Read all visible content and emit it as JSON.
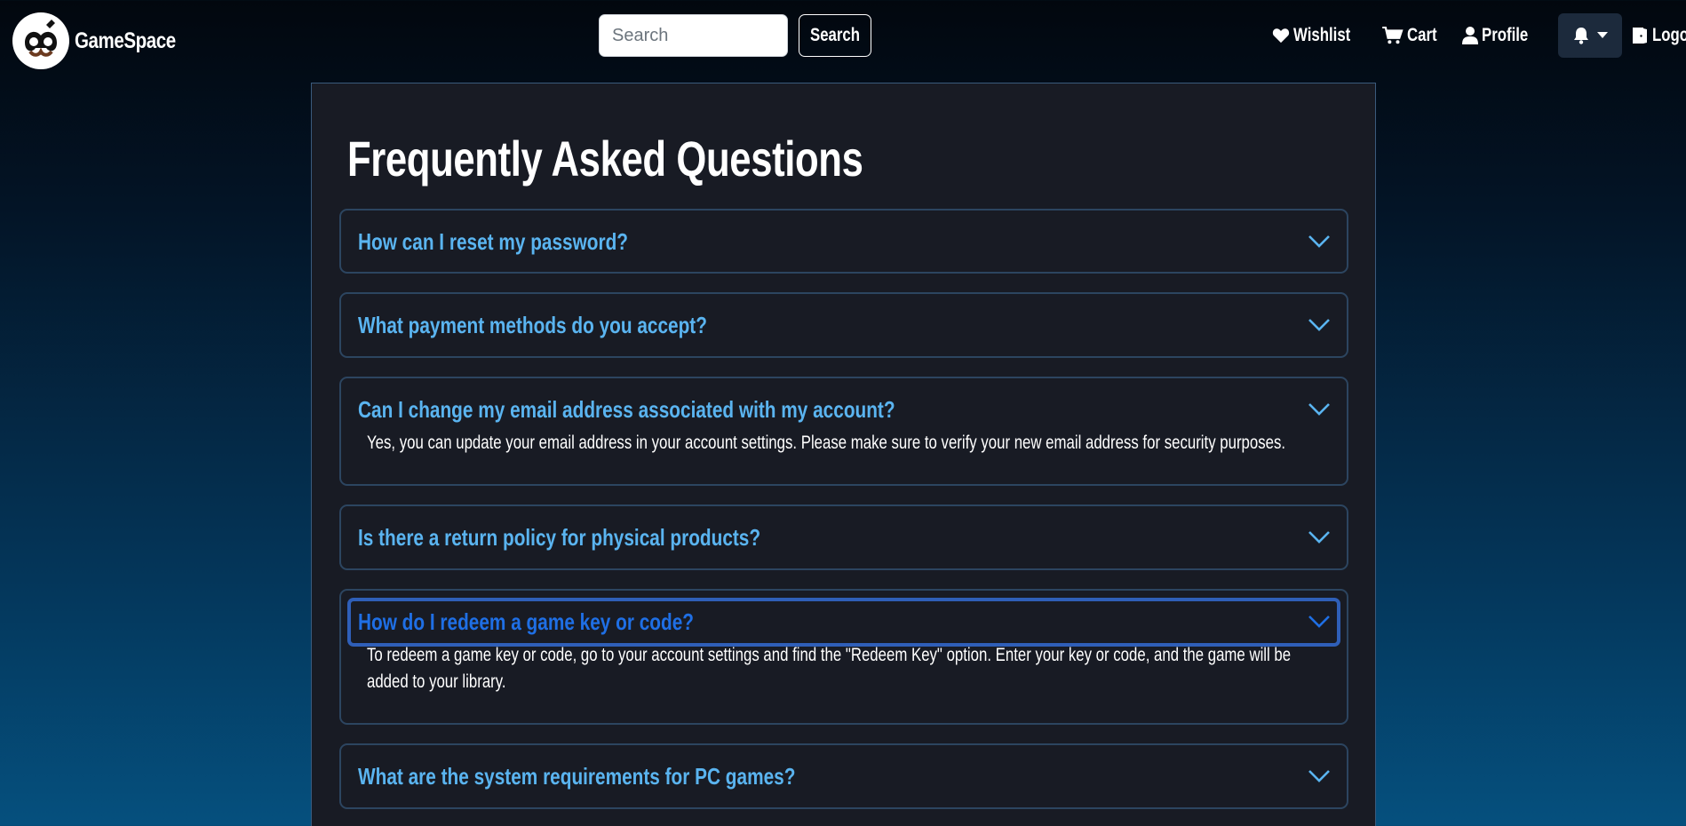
{
  "navbar": {
    "brand": "GameSpace",
    "search_placeholder": "Search",
    "search_button": "Search",
    "links": {
      "wishlist": "Wishlist",
      "cart": "Cart",
      "profile": "Profile",
      "logout": "Logout"
    }
  },
  "page": {
    "title": "Frequently Asked Questions"
  },
  "faq": [
    {
      "question": "How can I reset my password?",
      "answer": ""
    },
    {
      "question": "What payment methods do you accept?",
      "answer": ""
    },
    {
      "question": "Can I change my email address associated with my account?",
      "answer": "Yes, you can update your email address in your account settings. Please make sure to verify your new email address for security purposes."
    },
    {
      "question": "Is there a return policy for physical products?",
      "answer": ""
    },
    {
      "question": "How do I redeem a game key or code?",
      "answer": "To redeem a game key or code, go to your account settings and find the \"Redeem Key\" option. Enter your key or code, and the game will be added to your library."
    },
    {
      "question": "What are the system requirements for PC games?",
      "answer": ""
    }
  ],
  "colors": {
    "accent": "#5ab4f0",
    "focus": "#1f6fe5",
    "panel": "#181b24"
  },
  "icons": [
    "logo-icon",
    "heart-icon",
    "cart-icon",
    "user-icon",
    "bell-icon",
    "caret-down-icon",
    "logout-icon",
    "chevron-down-icon"
  ]
}
